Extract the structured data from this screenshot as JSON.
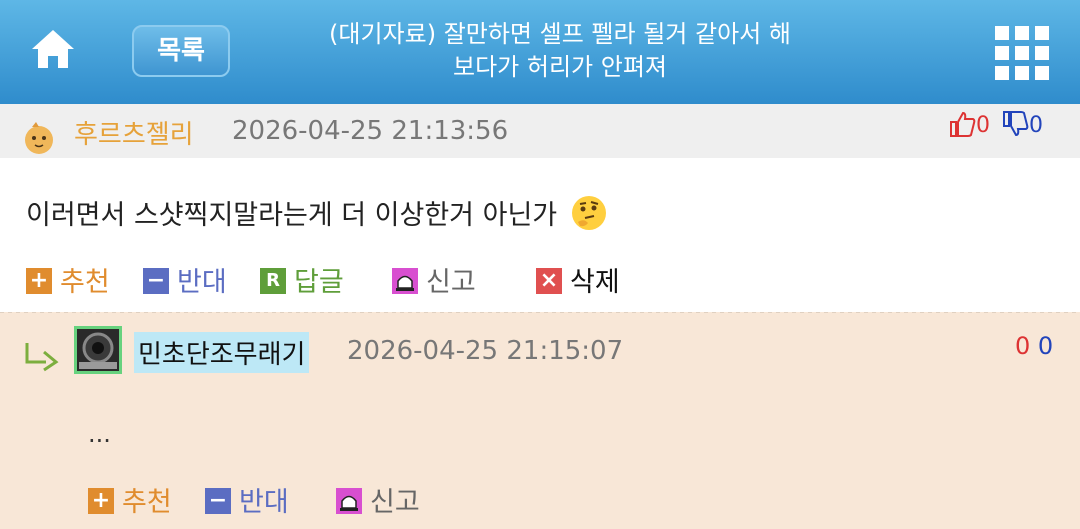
{
  "header": {
    "list_label": "목록",
    "title_line1": "(대기자료) 잘만하면 셀프 펠라 될거 같아서 해",
    "title_line2": "보다가 허리가 안펴져"
  },
  "comment1": {
    "author": "후르츠젤리",
    "datetime": "2026-04-25 21:13:56",
    "likes": "0",
    "dislikes": "0",
    "body": "이러면서 스샷찍지말라는게 더 이상한거 아닌가",
    "actions": {
      "recommend": "추천",
      "oppose": "반대",
      "reply": "답글",
      "report": "신고",
      "delete": "삭제"
    }
  },
  "comment2": {
    "author": "민초단조무래기",
    "datetime": "2026-04-25 21:15:07",
    "likes": "0",
    "dislikes": "0",
    "body": "...",
    "actions": {
      "recommend": "추천",
      "oppose": "반대",
      "report": "신고"
    }
  },
  "colors": {
    "header_top": "#5eb7e6",
    "header_bottom": "#2f8ccc",
    "reply_bg": "#f8e7d7",
    "accent_orange": "#e08c2e",
    "blue": "#5b6dc2"
  }
}
